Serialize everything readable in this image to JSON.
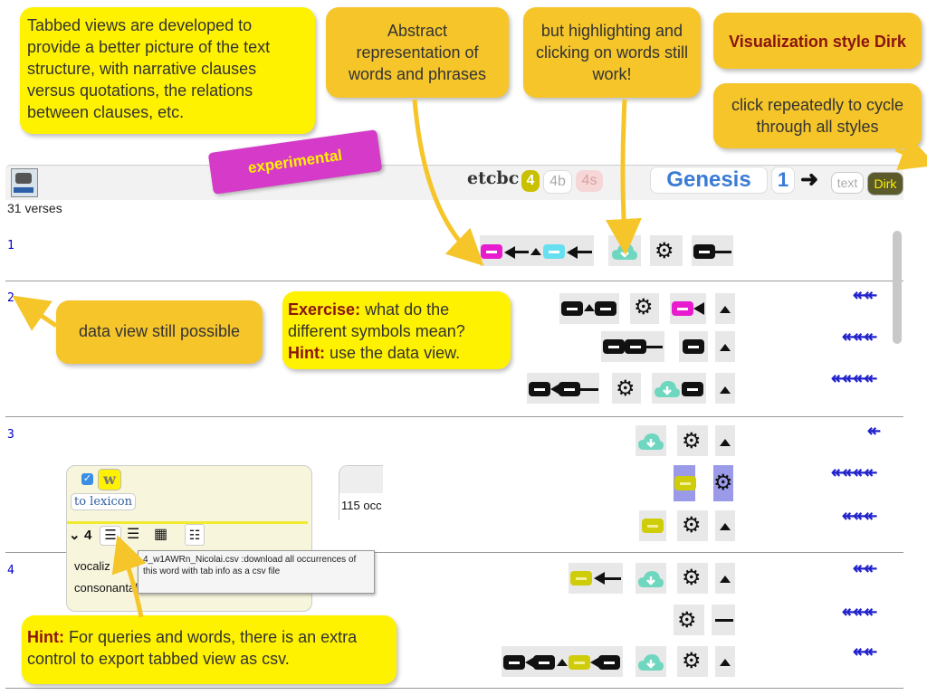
{
  "notes": {
    "tabbed": "Tabbed views are developed to provide a better picture of the text structure, with narrative clauses versus quotations, the relations between clauses, etc.",
    "abstract": "Abstract representation of words and phrases",
    "highlight": "but highlighting and clicking on words still work!",
    "style_title": "Visualization style Dirk",
    "cycle": "click repeatedly to cycle through all styles",
    "experimental": "experimental",
    "dataview": "data view still possible",
    "exercise_bold1": "Exercise:",
    "exercise_text1": " what do the different symbols mean?",
    "exercise_bold2": "Hint:",
    "exercise_text2": " use the data view.",
    "hint_bold": "Hint:",
    "hint_text": " For queries and words, there is an extra control to export tabbed view as csv."
  },
  "app": {
    "brand": "etcbc",
    "versions": [
      "4",
      "4b",
      "4s"
    ],
    "book": "Genesis",
    "chapter": "1",
    "text_btn": "text",
    "style_btn": "Dirk",
    "verse_count": "31 verses"
  },
  "verses": [
    "1",
    "2",
    "3",
    "4"
  ],
  "panel": {
    "w_label": "w",
    "lexicon_link": "to lexicon",
    "count": "4",
    "vocal": "vocaliz",
    "consonant": "consonantal",
    "occurrences": "115 occ",
    "tooltip": "4_w1AWRn_Nicolai.csv :download all occurrences of this word with tab info as a csv file"
  },
  "arrows": [
    "↞↞",
    "↞↞↞",
    "↞↞↞↞",
    "↞",
    "↞↞↞↞",
    "↞↞↞",
    "↞↞",
    "↞↞↞",
    "↞↞"
  ],
  "colors": {
    "note_yellow": "#fff200",
    "note_orange": "#f5c52a",
    "experimental": "#d63ac8",
    "book_blue": "#3a7bd5",
    "arrow_blue": "#2222cc"
  }
}
